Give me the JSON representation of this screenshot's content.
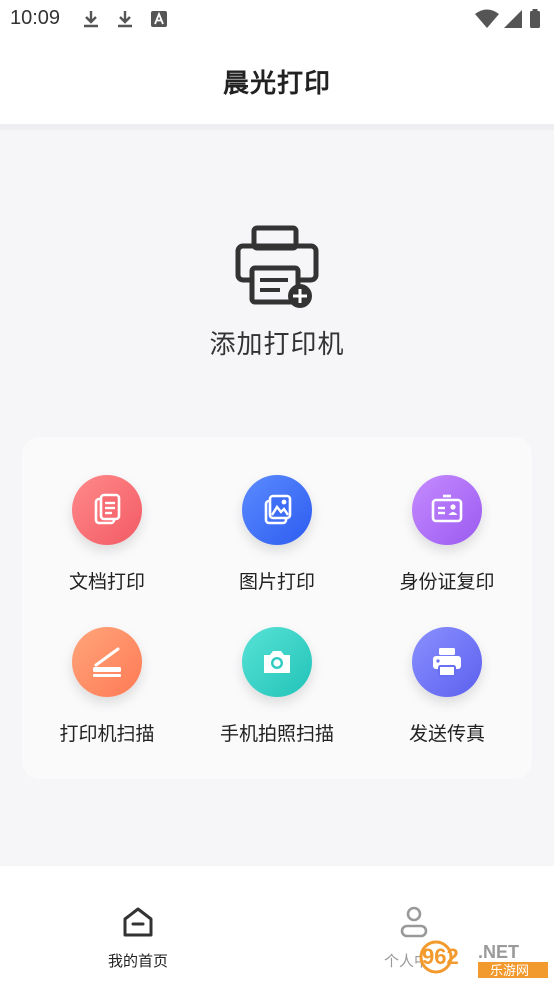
{
  "status_bar": {
    "time": "10:09"
  },
  "header": {
    "title": "晨光打印"
  },
  "add_printer": {
    "label": "添加打印机"
  },
  "functions": [
    {
      "label": "文档打印",
      "icon": "document-icon",
      "color_from": "#ff8a8a",
      "color_to": "#f25a64"
    },
    {
      "label": "图片打印",
      "icon": "image-icon",
      "color_from": "#5c8bff",
      "color_to": "#2c5cf0"
    },
    {
      "label": "身份证复印",
      "icon": "id-card-icon",
      "color_from": "#c58bff",
      "color_to": "#9b5af0"
    },
    {
      "label": "打印机扫描",
      "icon": "scanner-icon",
      "color_from": "#ffa57a",
      "color_to": "#ff7a55"
    },
    {
      "label": "手机拍照扫描",
      "icon": "camera-icon",
      "color_from": "#58e2d6",
      "color_to": "#22c3b8"
    },
    {
      "label": "发送传真",
      "icon": "fax-icon",
      "color_from": "#8a90ff",
      "color_to": "#5c60ee"
    }
  ],
  "tabbar": {
    "home_label": "我的首页",
    "profile_label": "个人中心"
  },
  "watermark": {
    "text": "962.NET",
    "sub": "乐游网"
  }
}
